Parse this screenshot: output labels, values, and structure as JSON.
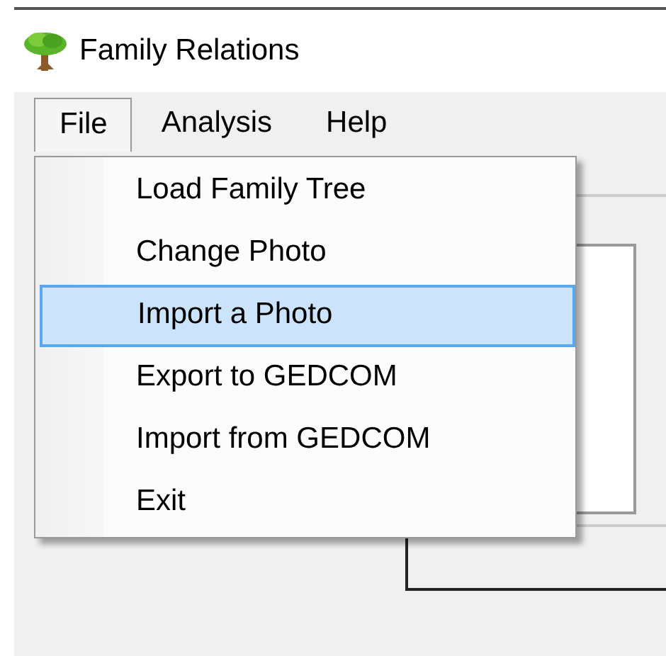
{
  "window": {
    "title": "Family Relations"
  },
  "menu_bar": [
    {
      "label": "File",
      "selected": true
    },
    {
      "label": "Analysis",
      "selected": false
    },
    {
      "label": "Help",
      "selected": false
    }
  ],
  "file_menu": [
    {
      "label": "Load Family Tree",
      "selected": false
    },
    {
      "label": "Change Photo",
      "selected": false
    },
    {
      "label": "Import a Photo",
      "selected": true
    },
    {
      "label": "Export to GEDCOM",
      "selected": false
    },
    {
      "label": "Import from GEDCOM",
      "selected": false
    },
    {
      "label": "Exit",
      "selected": false
    }
  ]
}
